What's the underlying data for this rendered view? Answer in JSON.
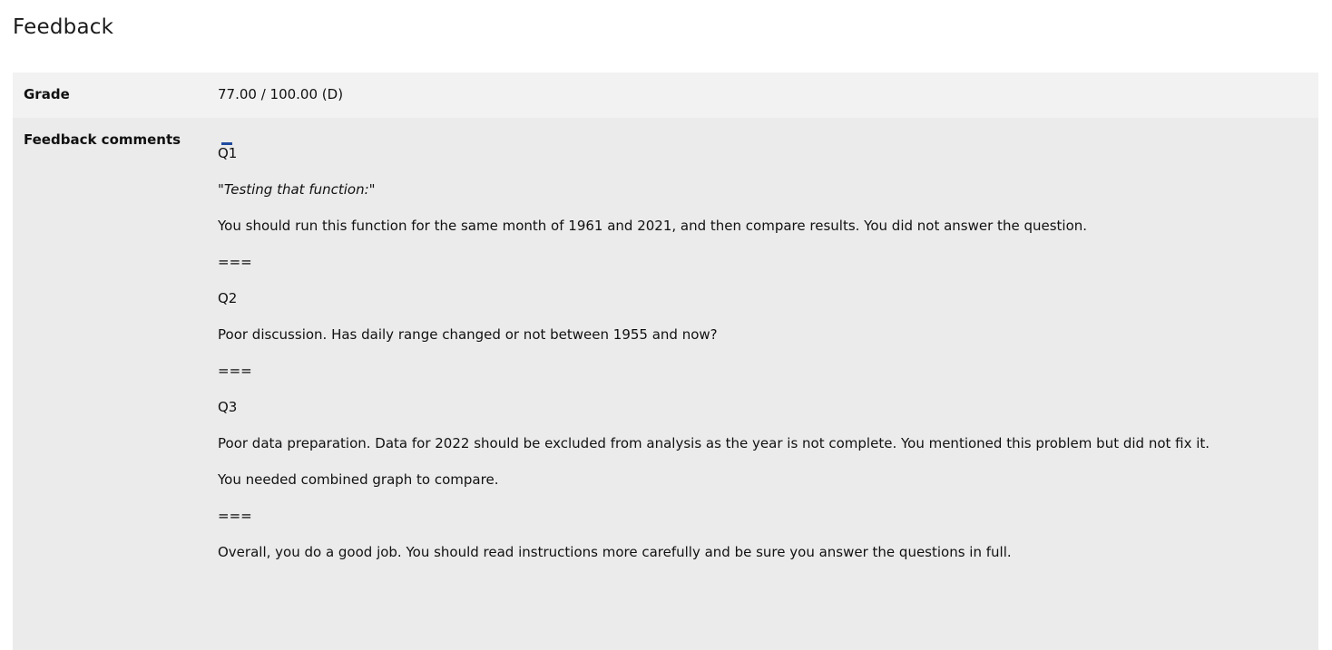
{
  "page": {
    "heading": "Feedback"
  },
  "grade": {
    "label": "Grade",
    "value": "77.00 / 100.00 (D)"
  },
  "feedback": {
    "label": "Feedback comments",
    "toggle_icon": "collapse-minus-icon",
    "toggle_color": "#1f4ba0",
    "lines": [
      "Q1",
      "\"Testing that function:\"",
      "You should run this function for the same month of 1961 and 2021, and then compare results. You did not answer the question.",
      "===",
      "Q2",
      "Poor discussion. Has daily range changed or not between 1955 and now?",
      "===",
      "Q3",
      "Poor data preparation. Data for 2022 should be excluded from analysis as the year is not complete. You mentioned this problem but did not fix it.",
      "You needed combined graph to compare.",
      "===",
      "Overall, you do a good job. You should read instructions more carefully and be sure you answer the questions in full."
    ]
  }
}
